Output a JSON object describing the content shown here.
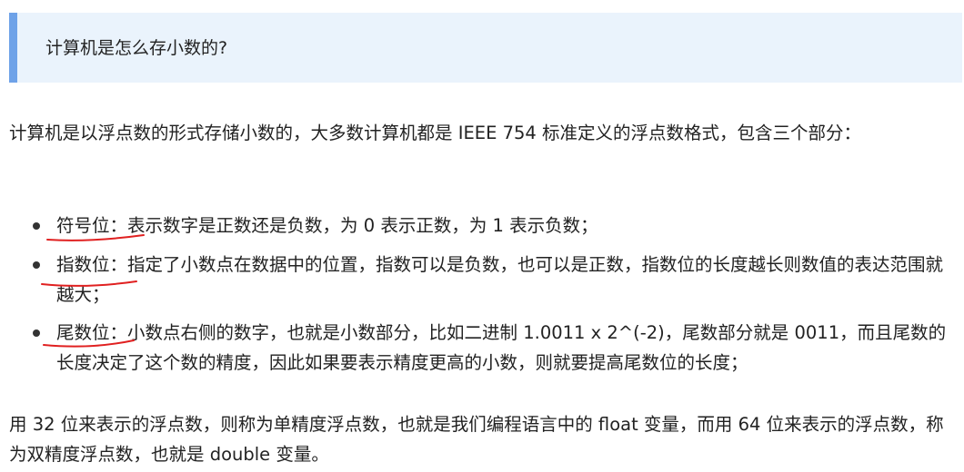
{
  "callout": {
    "text": "计算机是怎么存小数的?"
  },
  "intro": "计算机是以浮点数的形式存储小数的，大多数计算机都是 IEEE 754 标准定义的浮点数格式，包含三个部分：",
  "bullets": [
    {
      "term": "符号位：",
      "text": "表示数字是正数还是负数，为 0 表示正数，为 1 表示负数；"
    },
    {
      "term": "指数位：",
      "text": "指定了小数点在数据中的位置，指数可以是负数，也可以是正数，指数位的长度越长则数值的表达范围就越大；"
    },
    {
      "term": "尾数位：",
      "text": "小数点右侧的数字，也就是小数部分，比如二进制 1.0011 x 2^(-2)，尾数部分就是 0011，而且尾数的长度决定了这个数的精度，因此如果要表示精度更高的小数，则就要提高尾数位的长度；"
    }
  ],
  "outro": "用 32 位来表示的浮点数，则称为单精度浮点数，也就是我们编程语言中的 float 变量，而用 64 位来表示的浮点数，称为双精度浮点数，也就是 double 变量。",
  "colors": {
    "callout_bg": "#eaf3fc",
    "callout_border": "#6ea2e8",
    "annotation_ink": "#e02020",
    "text": "#222222"
  }
}
